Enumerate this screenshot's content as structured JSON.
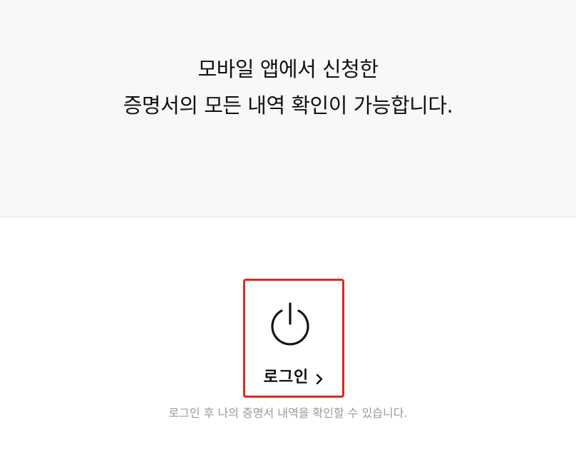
{
  "hero": {
    "line1": "모바일 앱에서 신청한",
    "line2": "증명서의 모든 내역 확인이 가능합니다."
  },
  "login": {
    "label": "로그인",
    "icon": "power-icon",
    "chevron": "chevron-right-icon",
    "highlight_color": "#e3261c"
  },
  "helper_text": "로그인 후 나의 증명서 내역을 확인할 수 있습니다."
}
